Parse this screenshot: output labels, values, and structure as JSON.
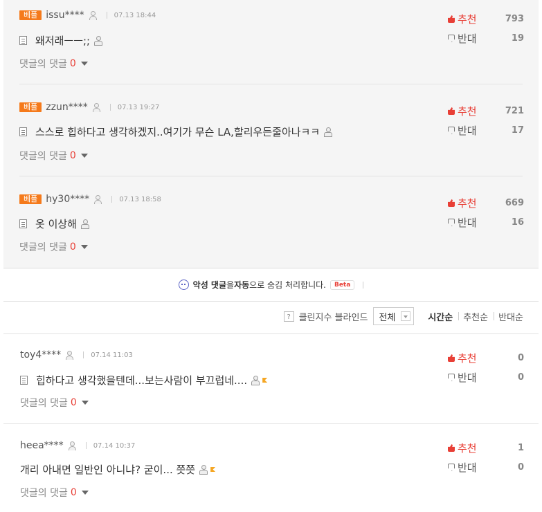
{
  "best_comments": [
    {
      "badge": "베플",
      "user": "issu****",
      "date": "07.13 18:44",
      "text": "왜저래ㅡㅡ;;",
      "replies_label": "댓글의 댓글",
      "replies_count": "0",
      "up_label": "추천",
      "up_count": "793",
      "down_label": "반대",
      "down_count": "19"
    },
    {
      "badge": "베플",
      "user": "zzun****",
      "date": "07.13 19:27",
      "text": "스스로 힙하다고 생각하겠지..여기가 무슨 LA,할리우든줄아나ㅋㅋ",
      "replies_label": "댓글의 댓글",
      "replies_count": "0",
      "up_label": "추천",
      "up_count": "721",
      "down_label": "반대",
      "down_count": "17"
    },
    {
      "badge": "베플",
      "user": "hy30****",
      "date": "07.13 18:58",
      "text": "옷 이상해",
      "replies_label": "댓글의 댓글",
      "replies_count": "0",
      "up_label": "추천",
      "up_count": "669",
      "down_label": "반대",
      "down_count": "16"
    }
  ],
  "notice": {
    "prefix": "악성 댓글",
    "mid": "을 ",
    "bold2": "자동",
    "suffix": "으로 숨김 처리합니다.",
    "beta": "Beta"
  },
  "sortbar": {
    "help_icon": "?",
    "clean_label": "클린지수 블라인드",
    "select_value": "전체",
    "options": [
      "시간순",
      "추천순",
      "반대순"
    ]
  },
  "comments": [
    {
      "user": "toy4****",
      "date": "07.14 11:03",
      "text": "힙하다고 생각했을텐데...보는사람이 부끄럽네....",
      "replies_label": "댓글의 댓글",
      "replies_count": "0",
      "up_label": "추천",
      "up_count": "0",
      "down_label": "반대",
      "down_count": "0"
    },
    {
      "user": "heea****",
      "date": "07.14 10:37",
      "text": "개리 아내면 일반인 아니냐? 굳이... 쯧쯧",
      "replies_label": "댓글의 댓글",
      "replies_count": "0",
      "up_label": "추천",
      "up_count": "1",
      "down_label": "반대",
      "down_count": "0"
    }
  ],
  "colors": {
    "accent_red": "#e83f36",
    "badge_orange": "#f57a1b",
    "best_bg": "#f5f5f5"
  }
}
